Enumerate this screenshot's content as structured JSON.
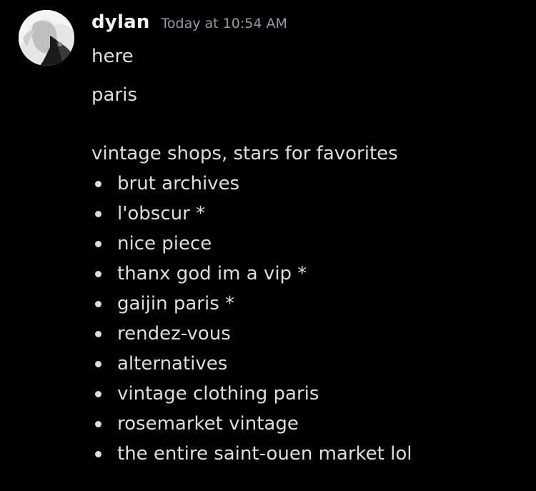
{
  "message": {
    "author": "dylan",
    "timestamp": "Today at 10:54 AM",
    "lines": {
      "l1": "here",
      "l2": "paris",
      "l3": "vintage shops, stars for favorites"
    },
    "list": [
      "brut archives",
      "l'obscur *",
      "nice piece",
      "thanx god im a vip *",
      "gaijin paris *",
      "rendez-vous",
      "alternatives",
      "vintage clothing paris",
      "rosemarket vintage",
      "the entire saint-ouen market lol"
    ]
  },
  "colors": {
    "background": "#000000",
    "username": "#f2f3f5",
    "timestamp": "#949ba4",
    "text": "#dbdee1"
  }
}
